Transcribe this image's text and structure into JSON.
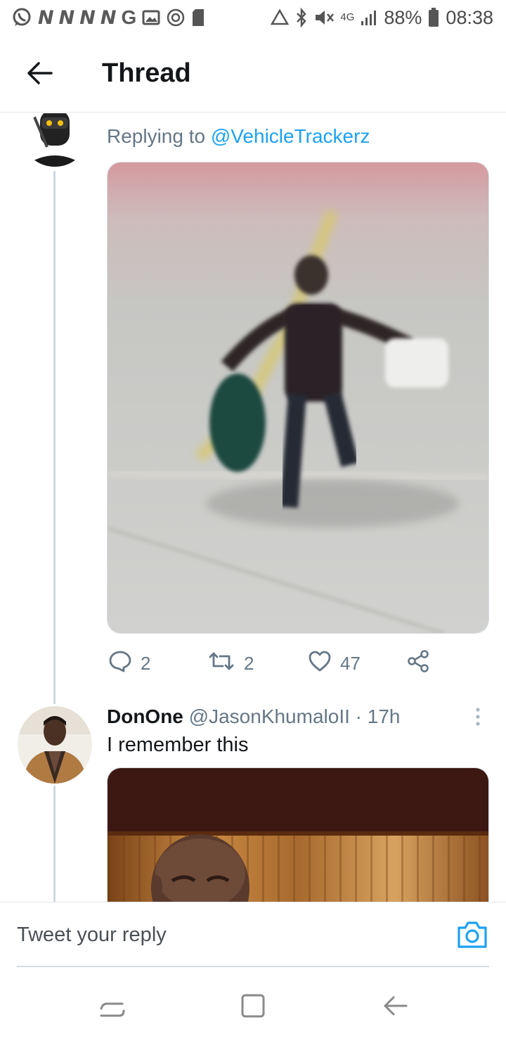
{
  "status_bar": {
    "battery": "88%",
    "time": "08:38",
    "network": "4G",
    "left_letters": [
      "N",
      "N",
      "N",
      "N",
      "G"
    ],
    "icons": [
      "whatsapp-icon",
      "image-icon",
      "target-icon",
      "sd-card-icon",
      "recycle-icon",
      "bluetooth-icon",
      "mute-icon",
      "signal-icon",
      "battery-icon"
    ]
  },
  "header": {
    "title": "Thread",
    "back_icon": "arrow-left-icon"
  },
  "thread": {
    "tweet1": {
      "replying_prefix": "Replying to",
      "replying_handle": "@VehicleTrackerz",
      "actions": {
        "reply_count": "2",
        "retweet_count": "2",
        "like_count": "47"
      }
    },
    "tweet2": {
      "display_name": "DonOne",
      "handle": "@JasonKhumaloII",
      "separator": "·",
      "time": "17h",
      "text": "I remember this"
    }
  },
  "composer": {
    "placeholder": "Tweet your reply",
    "camera_icon": "camera-icon"
  },
  "nav_bar": {
    "icons": [
      "recent-apps-icon",
      "home-icon",
      "back-icon"
    ]
  },
  "colors": {
    "accent": "#1da1f2",
    "secondary_text": "#657786",
    "divider": "#e1e8ed"
  }
}
